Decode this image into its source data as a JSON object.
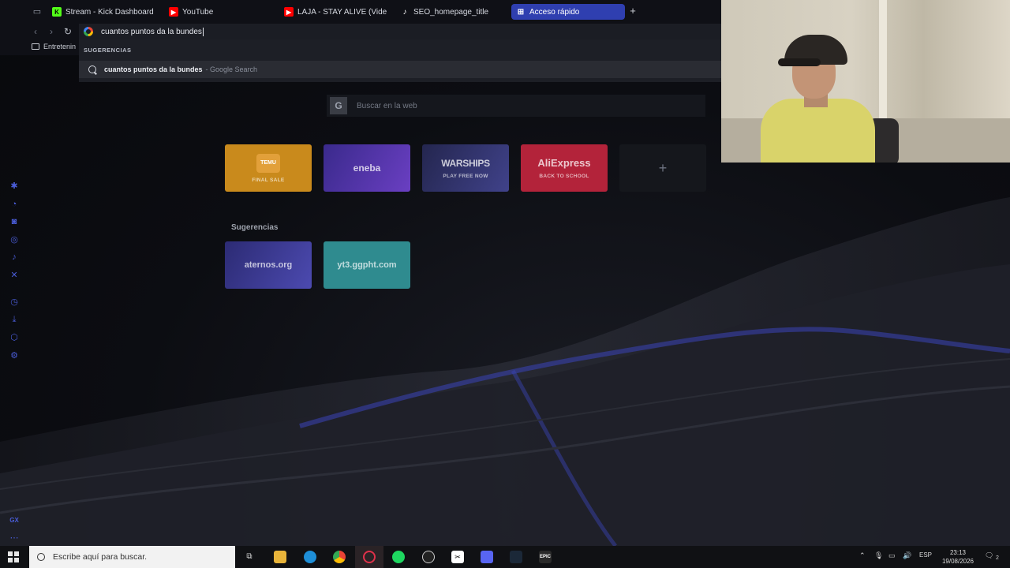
{
  "tabs": [
    {
      "label": "Stream - Kick Dashboard",
      "favicon": "kick-icon",
      "color": "#53fc18"
    },
    {
      "label": "YouTube",
      "favicon": "youtube-icon",
      "color": "#ff0000"
    },
    {
      "label": "LAJA - STAY ALIVE (Video",
      "favicon": "youtube-icon",
      "color": "#ff0000"
    },
    {
      "label": "SEO_homepage_title",
      "favicon": "tiktok-icon",
      "color": "#ffffff"
    },
    {
      "label": "Acceso rápido",
      "favicon": "grid-icon",
      "color": "#2f3fb0",
      "active": true
    }
  ],
  "address_bar": {
    "value": "cuantos puntos da la bundes"
  },
  "bookmarks": {
    "folder_label": "Entretenin"
  },
  "dropdown": {
    "header": "SUGERENCIAS",
    "suggestion": {
      "query": "cuantos puntos da la bundes",
      "source": "- Google Search"
    }
  },
  "page": {
    "search_placeholder": "Buscar en la web",
    "search_logo": "G",
    "speed_dials": [
      {
        "title": "TEMU",
        "subtitle": "FINAL SALE",
        "color": "#c98a1c"
      },
      {
        "title": "eneba",
        "subtitle": "",
        "color": "#4a2fa6"
      },
      {
        "title": "WARSHIPS",
        "subtitle": "PLAY FREE NOW",
        "color": "#2e2f6a"
      },
      {
        "title": "AliExpress",
        "subtitle": "BACK TO SCHOOL",
        "color": "#b3233a"
      }
    ],
    "add_tile": "+",
    "suggestions_title": "Sugerencias",
    "suggestion_dials": [
      {
        "title": "aternos.org",
        "color": "#3b3a8f"
      },
      {
        "title": "yt3.ggpht.com",
        "color": "#2f8b8f"
      }
    ]
  },
  "sidebar": {
    "icons": [
      "settings-gear-icon",
      "whatsapp-icon",
      "discord-icon",
      "instagram-icon",
      "tiktok-icon",
      "x-icon",
      "history-icon",
      "downloads-icon",
      "extensions-icon",
      "settings-icon"
    ],
    "bottom_label": "GX"
  },
  "taskbar": {
    "search_placeholder": "Escribe aquí para buscar.",
    "apps": [
      "task-view-icon",
      "file-explorer-icon",
      "edge-icon",
      "chrome-icon",
      "opera-gx-icon",
      "spotify-icon",
      "obs-icon",
      "capcut-icon",
      "discord-icon",
      "steam-icon",
      "epic-games-icon"
    ],
    "epic_label": "EPIC",
    "language": "ESP",
    "time": "23:13",
    "date": "19/08/2026",
    "notifications": "2"
  }
}
